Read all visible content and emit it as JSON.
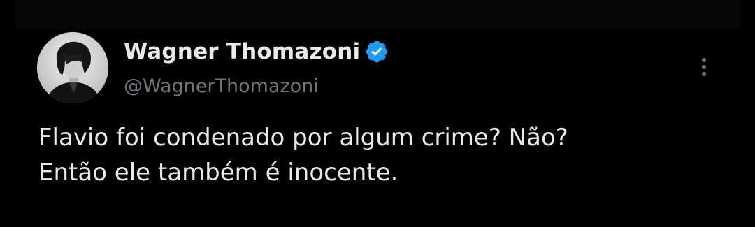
{
  "tweet": {
    "author": {
      "display_name": "Wagner Thomazoni",
      "handle": "@WagnerThomazoni",
      "verified": true,
      "verified_color": "#1d9bf0",
      "avatar_icon": "user-avatar-photo"
    },
    "text_lines": [
      "Flavio foi condenado por algum crime? Não?",
      "Então ele também é inocente."
    ],
    "more_icon": "more-vertical-icon"
  },
  "theme": {
    "background": "#000000",
    "text_primary": "#e7e9ea",
    "text_secondary": "#71767b"
  }
}
